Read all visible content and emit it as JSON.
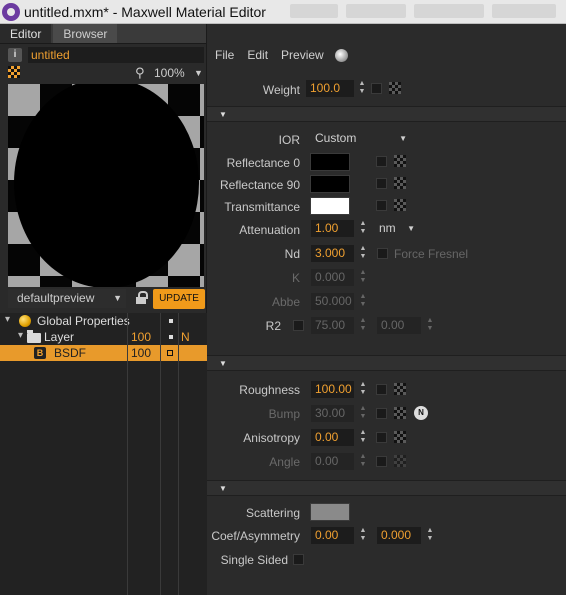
{
  "window": {
    "title": "untitled.mxm* - Maxwell Material Editor"
  },
  "left": {
    "tabs": [
      "Editor",
      "Browser"
    ],
    "material_name": "untitled",
    "zoom": "100%",
    "preset": "defaultpreview",
    "update_label": "UPDATE",
    "tree": [
      {
        "label": "Global Properties",
        "col1": "",
        "col2": "■",
        "col3": ""
      },
      {
        "label": "Layer",
        "col1": "100",
        "col2": "■",
        "col3": "N"
      },
      {
        "label": "BSDF",
        "col1": "100",
        "col2": "□",
        "col3": ""
      }
    ]
  },
  "right": {
    "menu": [
      "File",
      "Edit",
      "Preview"
    ],
    "weight": {
      "label": "Weight",
      "value": "100.0"
    },
    "ior": {
      "label": "IOR",
      "value": "Custom"
    },
    "reflectance0": {
      "label": "Reflectance 0",
      "color": "#000000"
    },
    "reflectance90": {
      "label": "Reflectance 90",
      "color": "#000000"
    },
    "transmittance": {
      "label": "Transmittance",
      "color": "#ffffff"
    },
    "attenuation": {
      "label": "Attenuation",
      "value": "1.00",
      "unit": "nm"
    },
    "nd": {
      "label": "Nd",
      "value": "3.000",
      "force_fresnel": "Force Fresnel"
    },
    "k": {
      "label": "K",
      "value": "0.000"
    },
    "abbe": {
      "label": "Abbe",
      "value": "50.000"
    },
    "r2": {
      "label": "R2",
      "value1": "75.00",
      "value2": "0.00"
    },
    "roughness": {
      "label": "Roughness",
      "value": "100.00"
    },
    "bump": {
      "label": "Bump",
      "value": "30.00",
      "badge": "N"
    },
    "anisotropy": {
      "label": "Anisotropy",
      "value": "0.00"
    },
    "angle": {
      "label": "Angle",
      "value": "0.00"
    },
    "scattering": {
      "label": "Scattering",
      "color": "#8a8a8a"
    },
    "coef": {
      "label": "Coef/Asymmetry",
      "value1": "0.00",
      "value2": "0.000"
    },
    "single_sided": {
      "label": "Single Sided"
    }
  },
  "colors": {
    "accent": "#f0a030",
    "update": "#f09a1a",
    "selected_row": "#e89a2b"
  }
}
